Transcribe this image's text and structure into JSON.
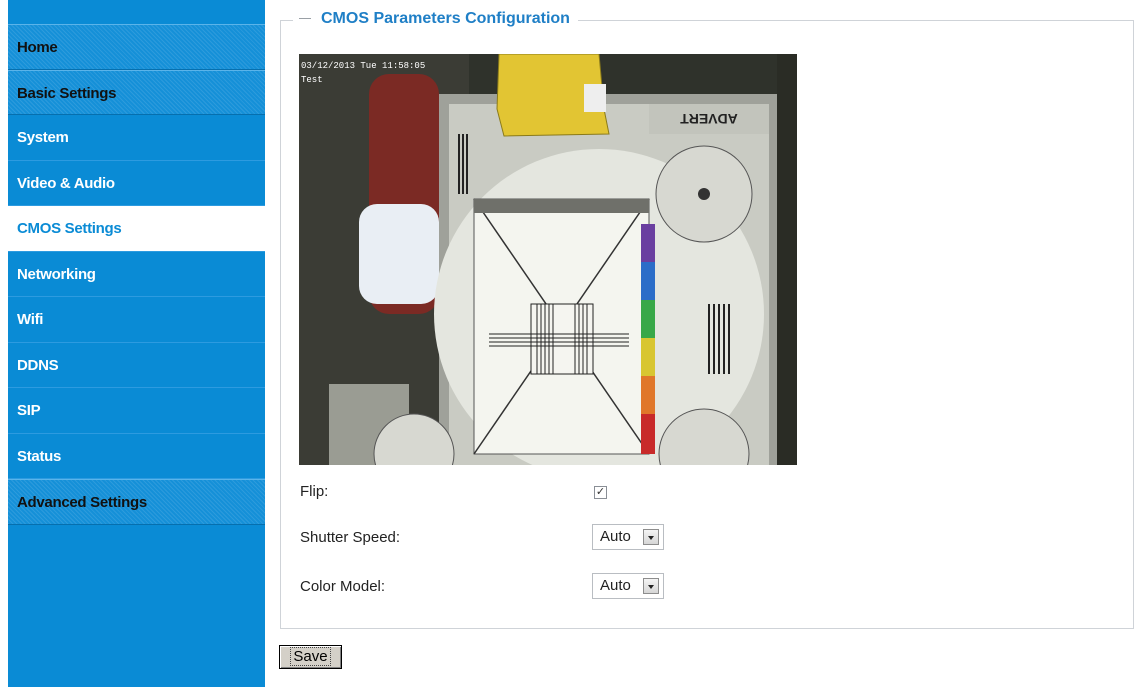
{
  "sidebar": {
    "items": [
      {
        "label": "Home",
        "kind": "section"
      },
      {
        "label": "Basic Settings",
        "kind": "section"
      },
      {
        "label": "System",
        "kind": "link"
      },
      {
        "label": "Video & Audio",
        "kind": "link"
      },
      {
        "label": "CMOS Settings",
        "kind": "active"
      },
      {
        "label": "Networking",
        "kind": "link"
      },
      {
        "label": "Wifi",
        "kind": "link"
      },
      {
        "label": "DDNS",
        "kind": "link"
      },
      {
        "label": "SIP",
        "kind": "link"
      },
      {
        "label": "Status",
        "kind": "link"
      },
      {
        "label": "Advanced Settings",
        "kind": "section"
      }
    ]
  },
  "config": {
    "title": "CMOS Parameters Configuration",
    "preview": {
      "overlay_date": "03/12/2013 Tue 11:58:05",
      "overlay_name": "Test"
    },
    "flip": {
      "label": "Flip:",
      "checked": true,
      "check_mark": "✓"
    },
    "shutter_speed": {
      "label": "Shutter Speed:",
      "value": "Auto"
    },
    "color_model": {
      "label": "Color Model:",
      "value": "Auto"
    }
  },
  "actions": {
    "save_label": "Save"
  },
  "colors": {
    "sidebar_blue": "#0a8bd5",
    "legend_blue": "#1f7fc6",
    "fieldset_border": "#cfd3d8"
  }
}
